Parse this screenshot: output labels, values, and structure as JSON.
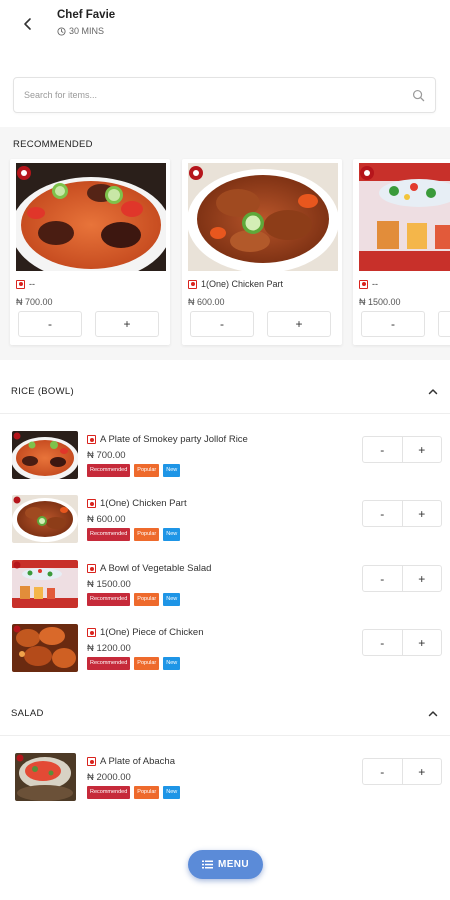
{
  "header": {
    "title": "Chef Favie",
    "time": "30 MINS"
  },
  "search": {
    "placeholder": "Search for items..."
  },
  "recommended": {
    "title": "RECOMMENDED",
    "items": [
      {
        "name": "--",
        "price": "₦ 700.00",
        "minus": "-",
        "plus": "+"
      },
      {
        "name": "1(One) Chicken Part",
        "price": "₦ 600.00",
        "minus": "-",
        "plus": "+"
      },
      {
        "name": "--",
        "price": "₦ 1500.00",
        "minus": "-",
        "plus": "+"
      }
    ]
  },
  "tags": {
    "recommended": "Recommended",
    "popular": "Popular",
    "new": "New"
  },
  "categories": [
    {
      "title": "RICE (BOWL)",
      "items": [
        {
          "name": "A Plate of Smokey party Jollof Rice",
          "price": "₦ 700.00",
          "minus": "-",
          "plus": "+"
        },
        {
          "name": "1(One) Chicken Part",
          "price": "₦ 600.00",
          "minus": "-",
          "plus": "+"
        },
        {
          "name": "A Bowl of Vegetable Salad",
          "price": "₦ 1500.00",
          "minus": "-",
          "plus": "+"
        },
        {
          "name": "1(One) Piece of Chicken",
          "price": "₦ 1200.00",
          "minus": "-",
          "plus": "+"
        }
      ]
    },
    {
      "title": "SALAD",
      "items": [
        {
          "name": "A Plate of Abacha",
          "price": "₦ 2000.00",
          "minus": "-",
          "plus": "+"
        }
      ]
    }
  ],
  "menu_button": {
    "label": "MENU"
  },
  "colors": {
    "accent": "#5b8bd8",
    "tag_recommended": "#c62a3a",
    "tag_popular": "#ee6a2c",
    "tag_new": "#1e95e6",
    "veg_mark": "#d9231d"
  }
}
